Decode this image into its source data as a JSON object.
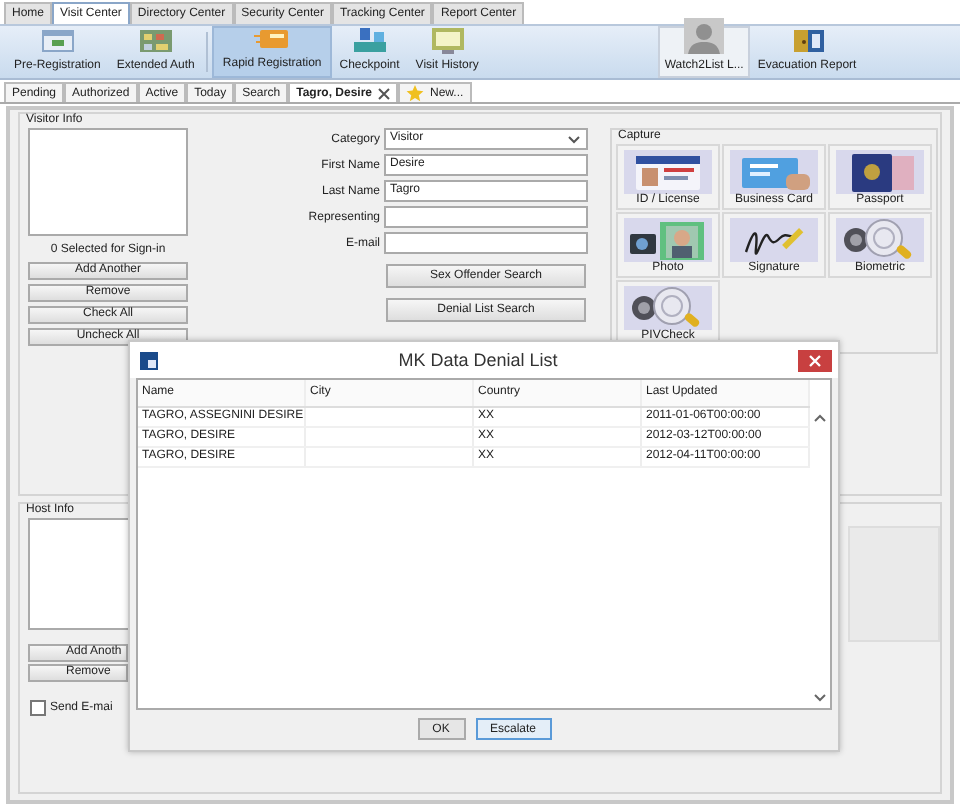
{
  "top_tabs": [
    {
      "label": "Home",
      "selected": false
    },
    {
      "label": "Visit Center",
      "selected": true
    },
    {
      "label": "Directory Center",
      "selected": false
    },
    {
      "label": "Security Center",
      "selected": false
    },
    {
      "label": "Tracking Center",
      "selected": false
    },
    {
      "label": "Report Center",
      "selected": false
    }
  ],
  "ribbon": [
    {
      "label": "Pre-Registration",
      "kind": "calendar",
      "selected": false,
      "divider_before": false
    },
    {
      "label": "Extended Auth",
      "kind": "grid",
      "selected": false,
      "divider_before": false
    },
    {
      "label": "Rapid Registration",
      "kind": "card",
      "selected": true,
      "divider_before": true
    },
    {
      "label": "Checkpoint",
      "kind": "desk",
      "selected": false,
      "divider_before": false
    },
    {
      "label": "Visit History",
      "kind": "screen",
      "selected": false,
      "divider_before": false
    },
    {
      "label": "Watch2List L...",
      "kind": "person",
      "selected": false,
      "divider_before": false
    },
    {
      "label": "Evacuation Report",
      "kind": "door",
      "selected": false,
      "divider_before": false
    }
  ],
  "subtabs": [
    {
      "label": "Pending",
      "selected": false,
      "kind": "plain"
    },
    {
      "label": "Authorized",
      "selected": false,
      "kind": "plain"
    },
    {
      "label": "Active",
      "selected": false,
      "kind": "plain"
    },
    {
      "label": "Today",
      "selected": false,
      "kind": "plain"
    },
    {
      "label": "Search",
      "selected": false,
      "kind": "plain"
    },
    {
      "label": "Tagro, Desire",
      "selected": true,
      "kind": "closable"
    },
    {
      "label": "New...",
      "selected": false,
      "kind": "new"
    }
  ],
  "visitor_info": {
    "title": "Visitor Info",
    "selected_count": "0 Selected for Sign-in",
    "buttons": [
      "Add Another",
      "Remove",
      "Check All",
      "Uncheck All"
    ]
  },
  "form": {
    "fields": [
      {
        "label": "Category",
        "kind": "select",
        "value": "Visitor"
      },
      {
        "label": "First Name",
        "kind": "text",
        "value": "Desire"
      },
      {
        "label": "Last Name",
        "kind": "text",
        "value": "Tagro"
      },
      {
        "label": "Representing",
        "kind": "text"
      },
      {
        "label": "E-mail",
        "kind": "text"
      }
    ],
    "buttons": [
      "Sex Offender Search",
      "Denial List Search"
    ]
  },
  "capture": {
    "title": "Capture",
    "tiles": [
      {
        "label": "ID / License",
        "kind": "id"
      },
      {
        "label": "Business Card",
        "kind": "card"
      },
      {
        "label": "Passport",
        "kind": "passport"
      },
      {
        "label": "Photo",
        "kind": "photo"
      },
      {
        "label": "Signature",
        "kind": "signature"
      },
      {
        "label": "Biometric",
        "kind": "fingerprint"
      },
      {
        "label": "PIVCheck",
        "kind": "fingerprint"
      }
    ]
  },
  "host_info": {
    "title": "Host Info",
    "buttons": [
      "Add Anoth",
      "Remove"
    ],
    "send_email": {
      "label": "Send E-mai",
      "checked": false
    }
  },
  "dialog": {
    "title": "MK Data Denial List",
    "columns": [
      "Name",
      "City",
      "Country",
      "Last Updated"
    ],
    "rows": [
      {
        "name": "TAGRO, ASSEGNINI DESIRE",
        "country": "XX",
        "last_updated": "2011-01-06T00:00:00"
      },
      {
        "name": "TAGRO, DESIRE",
        "country": "XX",
        "last_updated": "2012-03-12T00:00:00"
      },
      {
        "name": "TAGRO, DESIRE",
        "country": "XX",
        "last_updated": "2012-04-11T00:00:00"
      }
    ],
    "buttons": [
      {
        "label": "OK",
        "default": false
      },
      {
        "label": "Escalate",
        "default": true
      }
    ]
  }
}
